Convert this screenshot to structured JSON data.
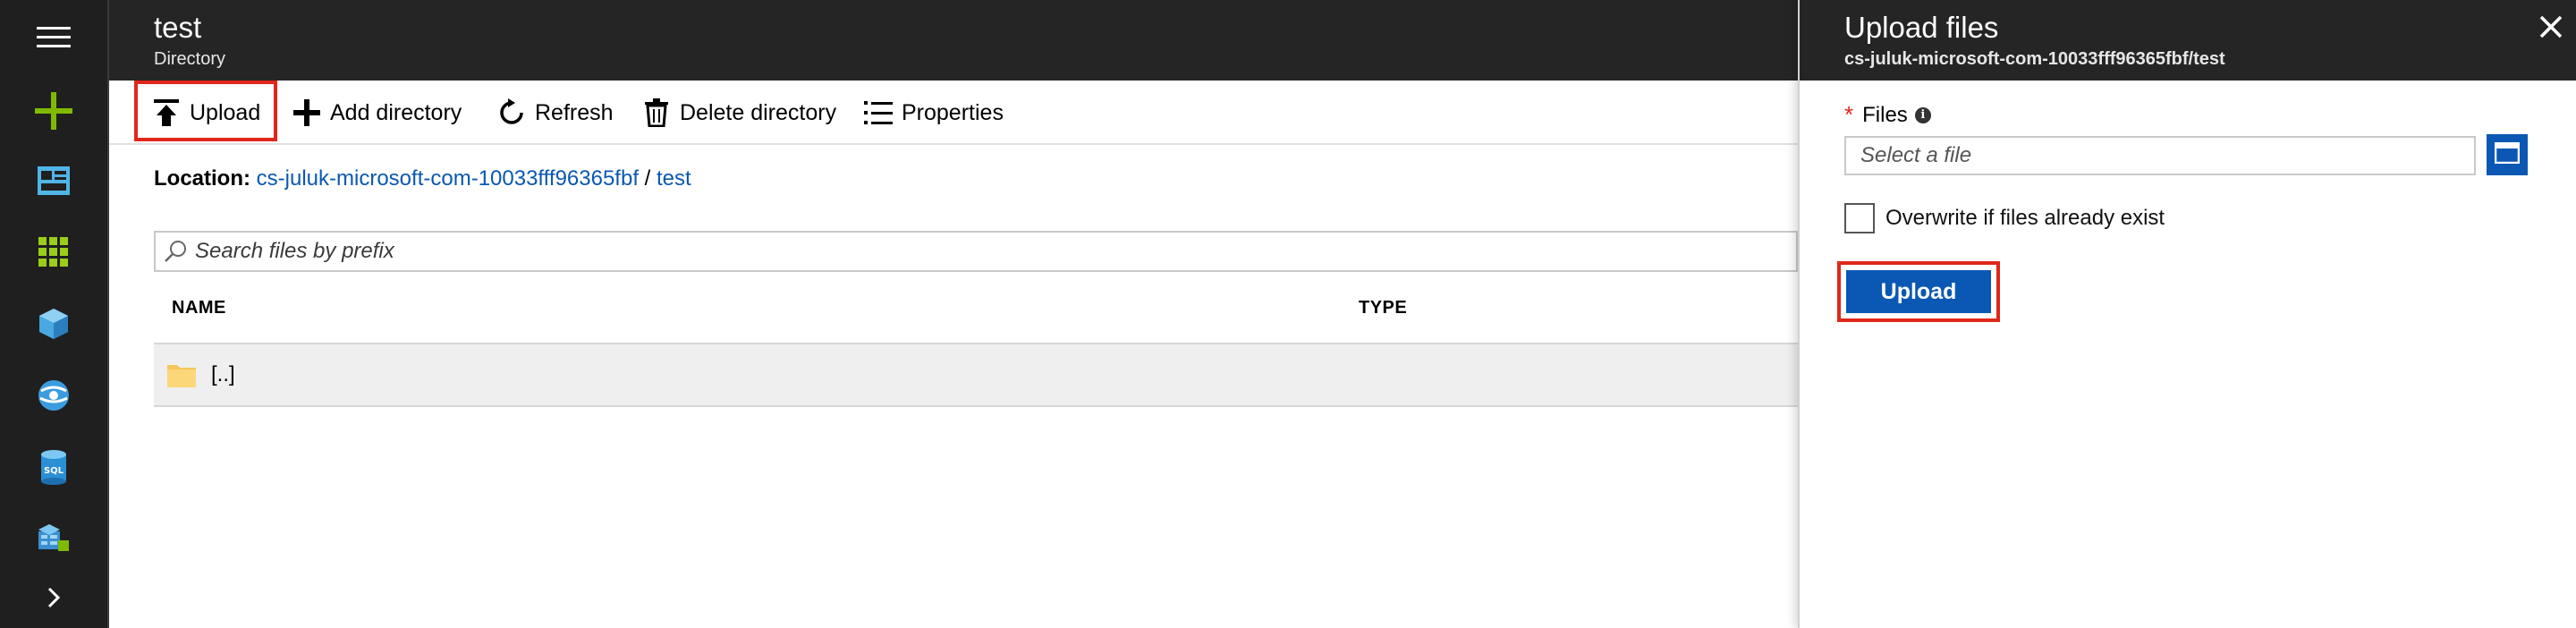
{
  "blade": {
    "title": "test",
    "subtitle": "Directory"
  },
  "nav": {
    "items": [
      "menu-icon",
      "create-resource-icon",
      "dashboard-icon",
      "all-services-icon",
      "resource-groups-icon",
      "app-services-icon",
      "sql-databases-icon",
      "storage-icon",
      "expand-icon"
    ]
  },
  "toolbar": {
    "upload_label": "Upload",
    "add_directory_label": "Add directory",
    "refresh_label": "Refresh",
    "delete_directory_label": "Delete directory",
    "properties_label": "Properties"
  },
  "location": {
    "label": "Location:",
    "share": "cs-juluk-microsoft-com-10033fff96365fbf",
    "separator": "/",
    "folder": "test"
  },
  "search": {
    "placeholder": "Search files by prefix"
  },
  "table": {
    "columns": [
      "NAME",
      "TYPE"
    ],
    "rows": [
      {
        "name": "[..]",
        "type": ""
      }
    ]
  },
  "panel": {
    "title": "Upload files",
    "subtitle": "cs-juluk-microsoft-com-10033fff96365fbf/test",
    "required_marker": "*",
    "files_label": "Files",
    "info_glyph": "i",
    "file_placeholder": "Select a file",
    "overwrite_label": "Overwrite if files already exist",
    "overwrite_checked": false,
    "upload_button": "Upload"
  },
  "colors": {
    "accent": "#0a58b3",
    "highlight": "#e0271a",
    "header_bg": "#252525",
    "nav_bg": "#1f1f1f",
    "create_green": "#7fba00"
  }
}
